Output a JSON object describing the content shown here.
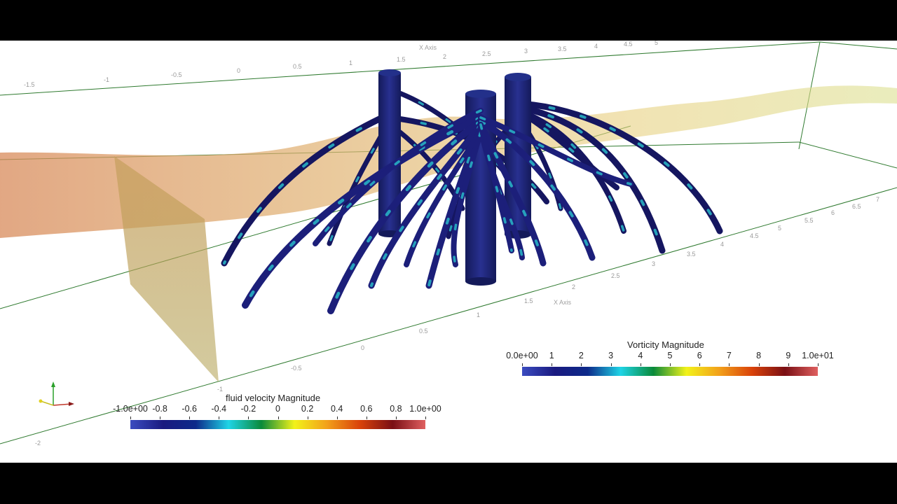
{
  "scene": {
    "x_axis_title_top": "X Axis",
    "x_axis_title_bottom": "X Axis",
    "top_edge_ticks": [
      "-1.5",
      "-1",
      "-0.5",
      "0",
      "0.5",
      "1",
      "1.5",
      "2",
      "2.5",
      "3",
      "3.5",
      "4",
      "4.5",
      "5"
    ],
    "bottom_edge_ticks": [
      "-2",
      "-1",
      "-0.5",
      "0",
      "0.5",
      "1",
      "1.5",
      "2",
      "2.5",
      "3",
      "3.5",
      "4",
      "4.5",
      "5",
      "5.5",
      "6",
      "6.5",
      "7"
    ]
  },
  "colorbars": {
    "velocity": {
      "title": "fluid velocity Magnitude",
      "labels": [
        "-1.0e+00",
        "-0.8",
        "-0.6",
        "-0.4",
        "-0.2",
        "0",
        "0.2",
        "0.4",
        "0.6",
        "0.8",
        "1.0e+00"
      ],
      "colormap": [
        "#3b4cc0",
        "#1a1a80",
        "#0d2a8a",
        "#1fd4e6",
        "#0a8a3a",
        "#f2f21a",
        "#f2a01a",
        "#d9420a",
        "#7a0f14",
        "#e06060"
      ]
    },
    "vorticity": {
      "title": "Vorticity Magnitude",
      "labels": [
        "0.0e+00",
        "1",
        "2",
        "3",
        "4",
        "5",
        "6",
        "7",
        "8",
        "9",
        "1.0e+01"
      ],
      "colormap": [
        "#3b4cc0",
        "#1a1a80",
        "#0d2a8a",
        "#1fd4e6",
        "#0a8a3a",
        "#f2f21a",
        "#f2a01a",
        "#d9420a",
        "#7a0f14",
        "#e06060"
      ]
    }
  },
  "colors": {
    "root": "#1c1f7a",
    "root_dark": "#151660",
    "stem": "#1e2470",
    "highlight": "#28b8c8",
    "surface": "#d9a060",
    "bbox": "#2f7a2f"
  },
  "orientation_axes": {
    "icon": "xyz-axes-icon"
  }
}
